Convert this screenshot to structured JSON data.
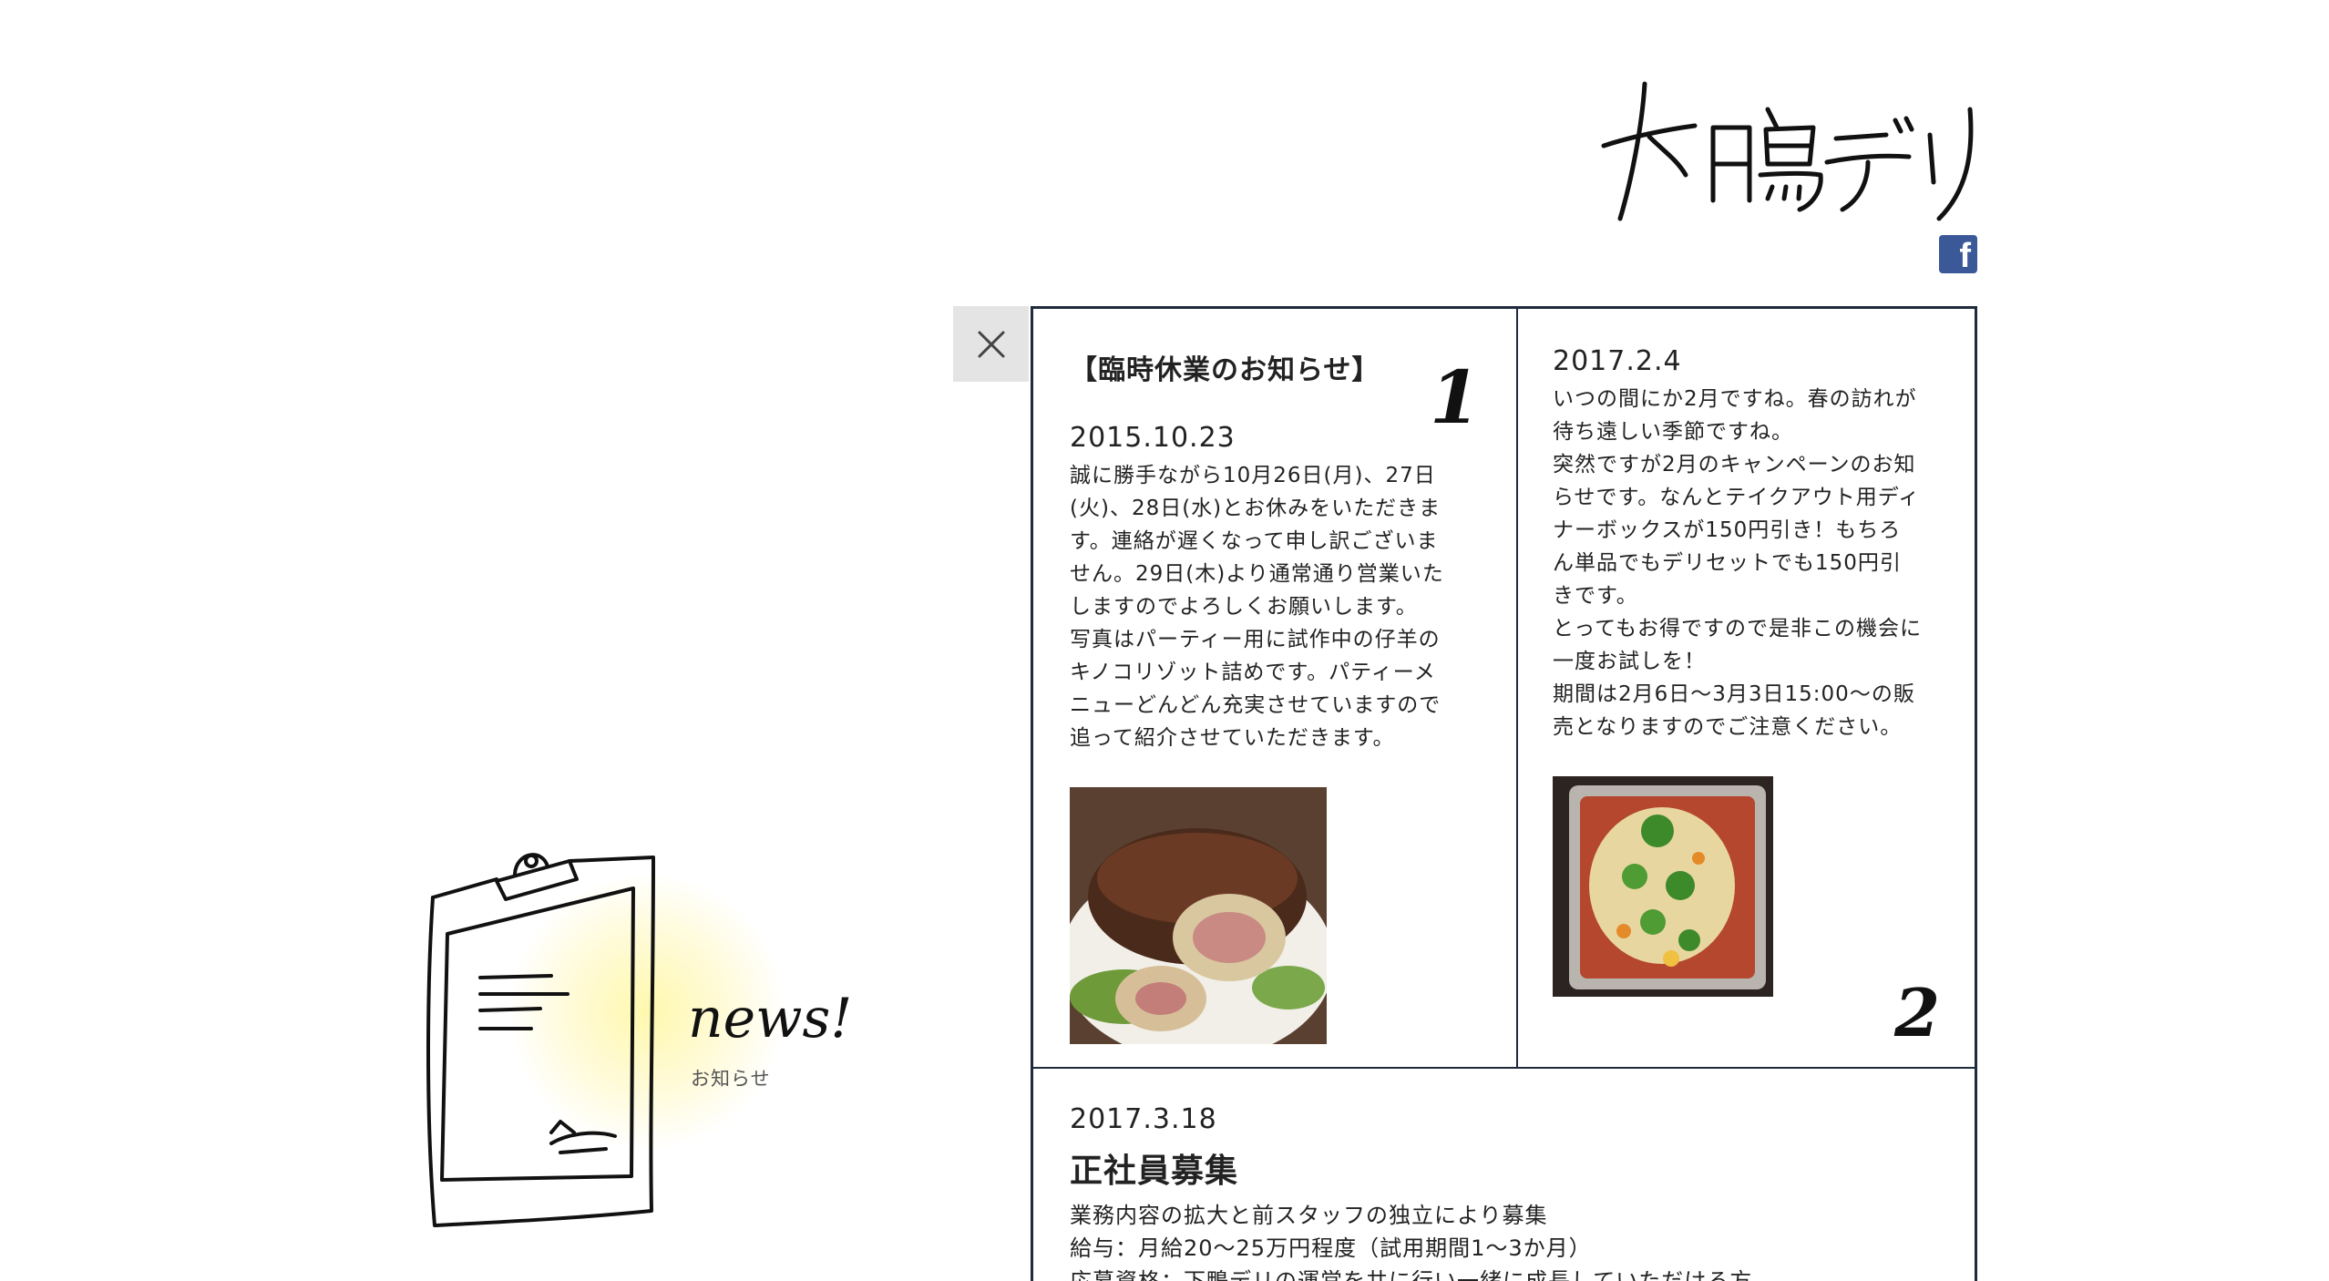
{
  "brand": {
    "logo_text": "下鴨デリ",
    "social_icon": "facebook-icon",
    "social_color": "#3b5998"
  },
  "illustration": {
    "title": "news!",
    "subtitle": "お知らせ",
    "icon": "clipboard-icon"
  },
  "close": {
    "icon": "close-icon"
  },
  "news": [
    {
      "number": "1",
      "title": "【臨時休業のお知らせ】",
      "date": "2015.10.23",
      "body": "誠に勝手ながら10月26日(月)、27日\n(火)、28日(水)とお休みをいただきま\nす。連絡が遅くなって申し訳ございま\nせん。29日(木)より通常通り営業いた\nしますのでよろしくお願いします。\n写真はパーティー用に試作中の仔羊の\nキノコリゾット詰めです。パティーメ\nニューどんどん充実させていますので\n追って紹介させていただきます。",
      "photo": "roast-lamb-photo"
    },
    {
      "number": "2",
      "date": "2017.2.4",
      "body": "いつの間にか2月ですね。春の訪れが\n待ち遠しい季節ですね。\n突然ですが2月のキャンペーンのお知\nらせです。なんとテイクアウト用ディ\nナーボックスが150円引き！もちろ\nん単品でもデリセットでも150円引\nきです。\nとってもお得ですので是非この機会に\n一度お試しを！\n期間は2月6日〜3月3日15:00〜の販\n売となりますのでご注意ください。",
      "photo": "deli-tray-photo"
    },
    {
      "date": "2017.3.18",
      "title": "正社員募集",
      "body": "業務内容の拡大と前スタッフの独立により募集\n給与：月給20〜25万円程度（試用期間1〜3か月）\n応募資格：下鴨デリの運営を共に行い一緒に成長していただける方。"
    }
  ]
}
